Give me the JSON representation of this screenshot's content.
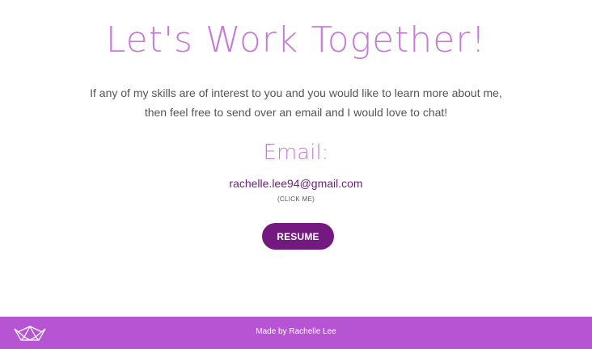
{
  "header": {
    "title": "Let's Work Together!"
  },
  "intro": {
    "line1": "If any of my skills are of interest to you and you would like to learn more about me,",
    "line2": "then feel free to send over an email and I would love to chat!"
  },
  "contact": {
    "email_heading": "Email:",
    "email": "rachelle.lee94@gmail.com",
    "click_hint": "(CLICK ME)"
  },
  "resume": {
    "label": "RESUME"
  },
  "footer": {
    "text": "Made by Rachelle Lee",
    "logo_icon": "crown-icon"
  },
  "colors": {
    "title": "#c77ad8",
    "email_link": "#6a1f78",
    "button": "#74197f",
    "footer": "#b654d3",
    "body_text": "#555555"
  }
}
